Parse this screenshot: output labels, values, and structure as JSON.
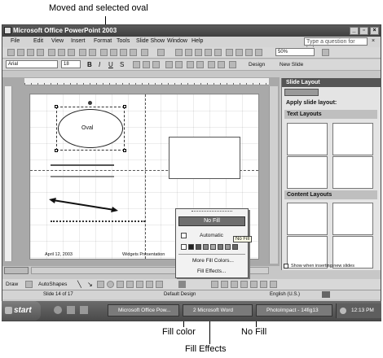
{
  "callouts": {
    "oval": "Moved and selected oval",
    "fill_color": "Fill color",
    "no_fill": "No Fill",
    "fill_effects": "Fill Effects"
  },
  "window": {
    "title": "Microsoft Office PowerPoint 2003",
    "help_placeholder": "Type a question for help"
  },
  "menu": [
    "File",
    "Edit",
    "View",
    "Insert",
    "Format",
    "Tools",
    "Slide Show",
    "Window",
    "Help"
  ],
  "toolbar": {
    "zoom": "50%",
    "font": "Arial",
    "font_size": "18",
    "design_label": "Design",
    "new_slide_label": "New Slide"
  },
  "slide": {
    "oval_label": "Oval",
    "footer_date": "April 12, 2003",
    "footer_center": "Widgets Presentation"
  },
  "fill_menu": {
    "no_fill": "No Fill",
    "automatic": "Automatic",
    "more_colors": "More Fill Colors...",
    "fill_effects": "Fill Effects...",
    "no_fill_hint": "No Fill"
  },
  "taskpane": {
    "title": "Slide Layout",
    "apply_label": "Apply slide layout:",
    "text_layouts": "Text Layouts",
    "content_layouts": "Content Layouts",
    "show_when_inserting": "Show when inserting new slides"
  },
  "drawbar": {
    "draw": "Draw",
    "autoshapes": "AutoShapes"
  },
  "status": {
    "slide_count": "Slide 14 of 17",
    "design": "Default Design",
    "language": "English (U.S.)"
  },
  "taskbar": {
    "start": "start",
    "item1": "Microsoft Office Pow...",
    "item2": "2 Microsoft Word",
    "item3": "PhotoImpact - 14fig13",
    "clock": "12:13 PM"
  },
  "colors": {
    "title_bar": "#4a4a4a",
    "panel_bg": "#e4e4e4",
    "section_bg": "#bfbfbf",
    "no_fill_highlight": "#6e6e6e"
  }
}
